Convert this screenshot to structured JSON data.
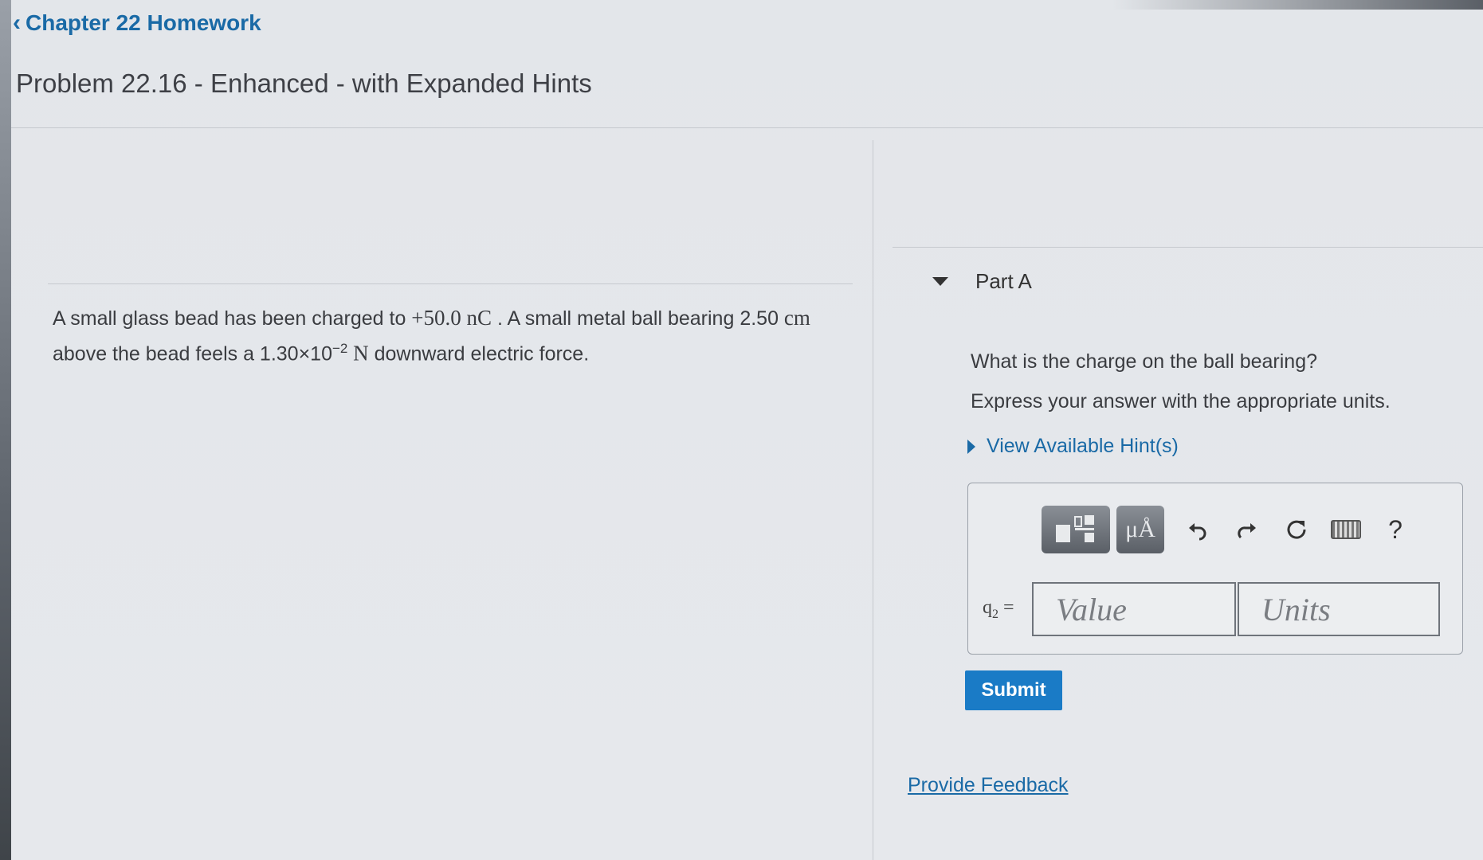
{
  "nav": {
    "back_label": "Chapter 22 Homework"
  },
  "problem": {
    "title": "Problem 22.16 - Enhanced - with Expanded Hints",
    "text_1": "A small glass bead has been charged to ",
    "charge": "+50.0 nC",
    "text_2": " . A small metal ball bearing 2.50 ",
    "cm": "cm",
    "text_3": "above the bead feels a 1.30×10",
    "exponent": "−2",
    "force_unit": " N",
    "text_4": " downward electric force."
  },
  "part": {
    "label": "Part A",
    "question": "What is the charge on the ball bearing?",
    "instruction": "Express your answer with the appropriate units.",
    "hints_label": "View Available Hint(s)"
  },
  "answer": {
    "variable": "q",
    "variable_sub": "2",
    "equals": " =",
    "value_placeholder": "Value",
    "units_placeholder": "Units",
    "help_symbol": "?"
  },
  "toolbar_icons": [
    "templates-icon",
    "units-mu-A-icon",
    "undo-icon",
    "redo-icon",
    "reset-icon",
    "keyboard-icon",
    "help-icon"
  ],
  "submit_label": "Submit",
  "feedback_label": "Provide Feedback",
  "colors": {
    "link": "#1a6aa6",
    "submit": "#1a7bc6"
  }
}
